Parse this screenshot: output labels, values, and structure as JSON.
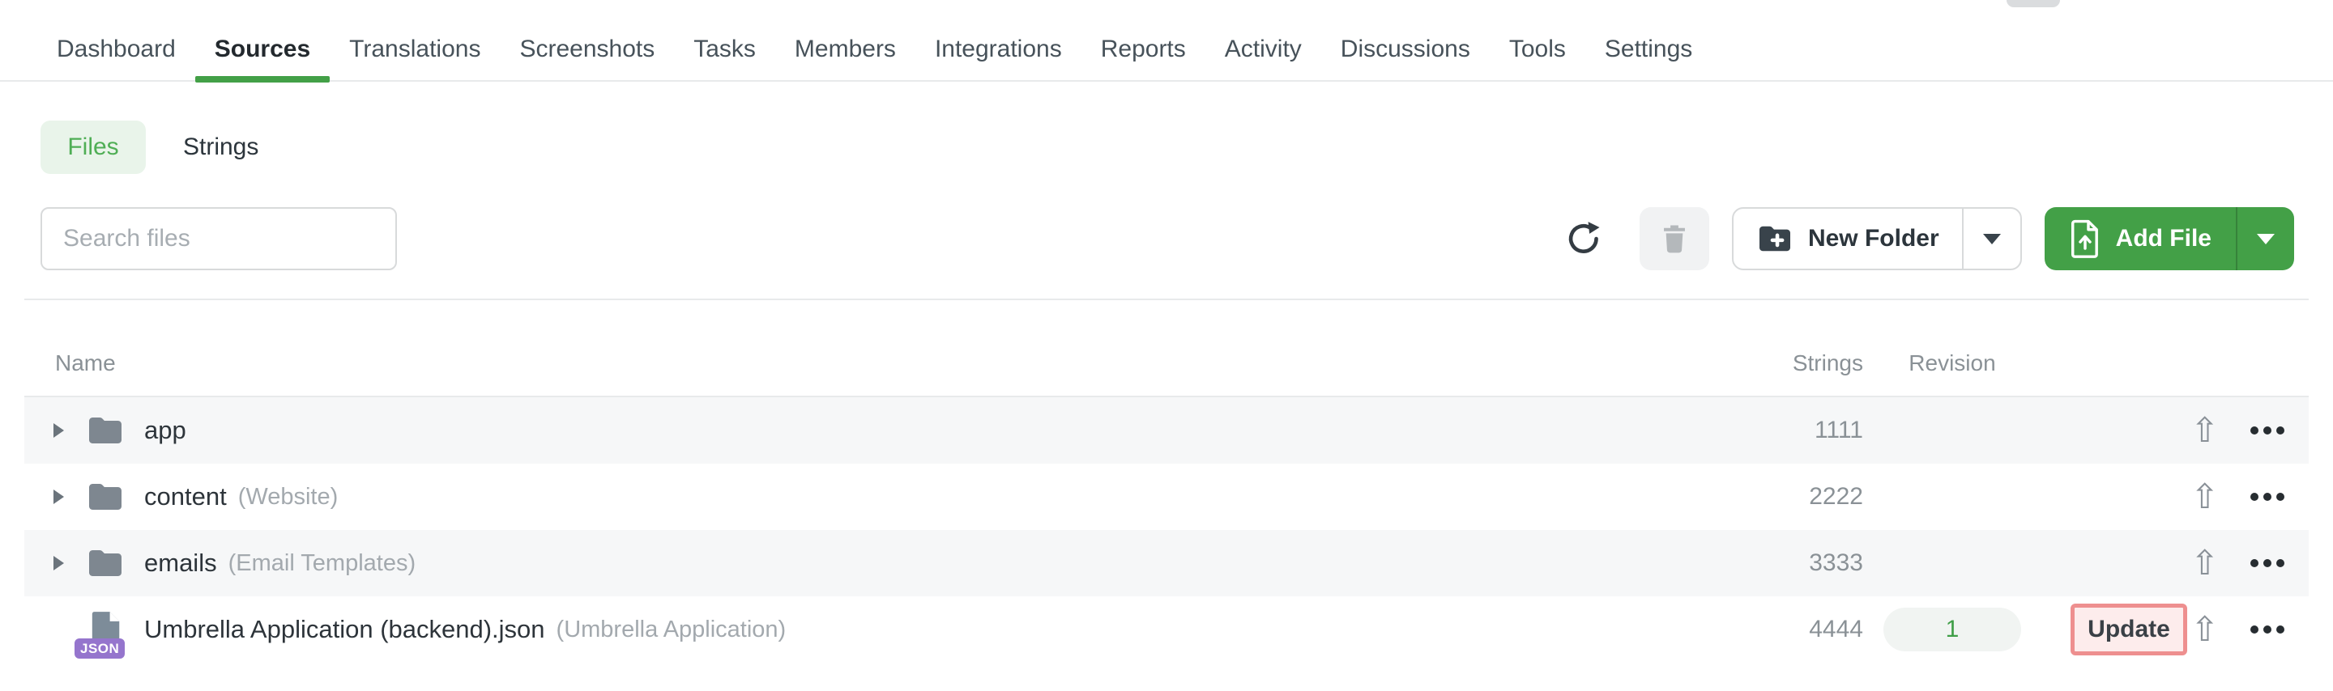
{
  "nav": {
    "items": [
      {
        "label": "Dashboard",
        "active": false
      },
      {
        "label": "Sources",
        "active": true
      },
      {
        "label": "Translations",
        "active": false
      },
      {
        "label": "Screenshots",
        "active": false
      },
      {
        "label": "Tasks",
        "active": false
      },
      {
        "label": "Members",
        "active": false
      },
      {
        "label": "Integrations",
        "active": false
      },
      {
        "label": "Reports",
        "active": false
      },
      {
        "label": "Activity",
        "active": false
      },
      {
        "label": "Discussions",
        "active": false
      },
      {
        "label": "Tools",
        "active": false
      },
      {
        "label": "Settings",
        "active": false
      }
    ]
  },
  "tabs": {
    "files_label": "Files",
    "strings_label": "Strings",
    "active": "Files"
  },
  "toolbar": {
    "search_placeholder": "Search files",
    "search_value": "",
    "new_folder_label": "New Folder",
    "add_file_label": "Add File"
  },
  "table": {
    "columns": {
      "name": "Name",
      "strings": "Strings",
      "revision": "Revision"
    },
    "rows": [
      {
        "kind": "folder",
        "name": "app",
        "note": "",
        "strings": "1111"
      },
      {
        "kind": "folder",
        "name": "content",
        "note": "(Website)",
        "strings": "2222"
      },
      {
        "kind": "folder",
        "name": "emails",
        "note": "(Email Templates)",
        "strings": "3333"
      },
      {
        "kind": "file",
        "file_badge": "JSON",
        "name": "Umbrella Application (backend).json",
        "note": "(Umbrella Application)",
        "strings": "4444",
        "revision": "1",
        "update_label": "Update"
      }
    ]
  },
  "icons": {
    "upload_glyph": "⇧"
  },
  "colors": {
    "accent_green": "#43a047",
    "files_tab_bg": "#e9f4ea",
    "files_tab_text": "#4fae55",
    "row_alt_bg": "#f6f7f8",
    "revision_text": "#3f9e47",
    "update_highlight_border": "#ee8f8f",
    "update_highlight_bg": "#fdecec",
    "json_badge_bg": "#9575cd",
    "muted_text": "#8a9196",
    "border": "#e8eaeb"
  }
}
